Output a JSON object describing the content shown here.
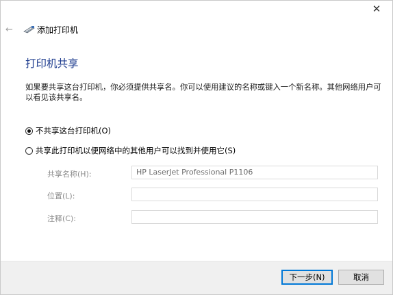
{
  "window": {
    "close_icon": "close-icon"
  },
  "header": {
    "back_icon": "back-arrow-icon",
    "wizard_icon": "printer-icon",
    "wizard_title": "添加打印机"
  },
  "main": {
    "heading": "打印机共享",
    "description": "如果要共享这台打印机，你必须提供共享名。你可以使用建议的名称或键入一个新名称。其他网络用户可以看见该共享名。",
    "radio_no_share": {
      "label": "不共享这台打印机(O)",
      "checked": true
    },
    "radio_share": {
      "label": "共享此打印机以便网络中的其他用户可以找到并使用它(S)",
      "checked": false
    },
    "fields": {
      "share_name": {
        "label": "共享名称(H):",
        "value": "HP LaserJet Professional P1106"
      },
      "location": {
        "label": "位置(L):",
        "value": ""
      },
      "comment": {
        "label": "注释(C):",
        "value": ""
      }
    }
  },
  "footer": {
    "next_label": "下一步(N)",
    "cancel_label": "取消"
  },
  "colors": {
    "heading": "#1f3d8f",
    "default_button_border": "#0078d7",
    "footer_bg": "#f0f0f0"
  }
}
